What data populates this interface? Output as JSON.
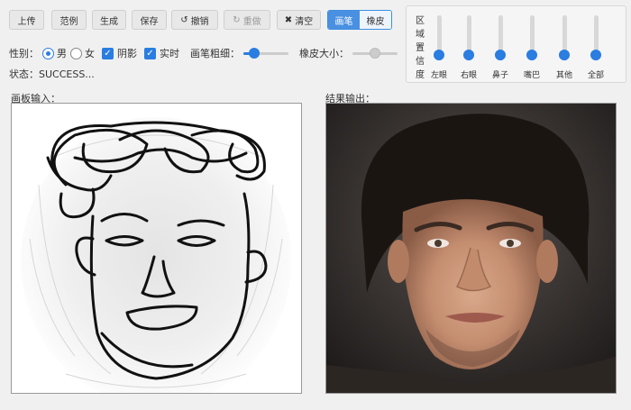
{
  "toolbar": {
    "upload": "上传",
    "examples": "范例",
    "generate": "生成",
    "save": "保存",
    "undo": "撤销",
    "redo": "重做",
    "clear": "清空",
    "pen": "画笔",
    "eraser": "橡皮"
  },
  "options": {
    "gender_label": "性别：",
    "male": "男",
    "female": "女",
    "shadow": "阴影",
    "realtime": "实时",
    "brush_size_label": "画笔粗细：",
    "eraser_size_label": "橡皮大小：",
    "brush_size_level": 0.15,
    "eraser_size_level": 0.5
  },
  "status": {
    "text": "状态：SUCCESS..."
  },
  "panels": {
    "input_title": "画板输入：",
    "output_title": "结果输出："
  },
  "confidence": {
    "title": [
      "区",
      "域",
      "置",
      "信",
      "度"
    ],
    "sliders": [
      {
        "label": "左眼",
        "level": 0.0
      },
      {
        "label": "右眼",
        "level": 0.0
      },
      {
        "label": "鼻子",
        "level": 0.0
      },
      {
        "label": "嘴巴",
        "level": 0.0
      },
      {
        "label": "其他",
        "level": 0.0
      },
      {
        "label": "全部",
        "level": 0.0
      }
    ]
  },
  "colors": {
    "accent": "#2a7de1",
    "toolbar_button": "#e8e8e8"
  }
}
